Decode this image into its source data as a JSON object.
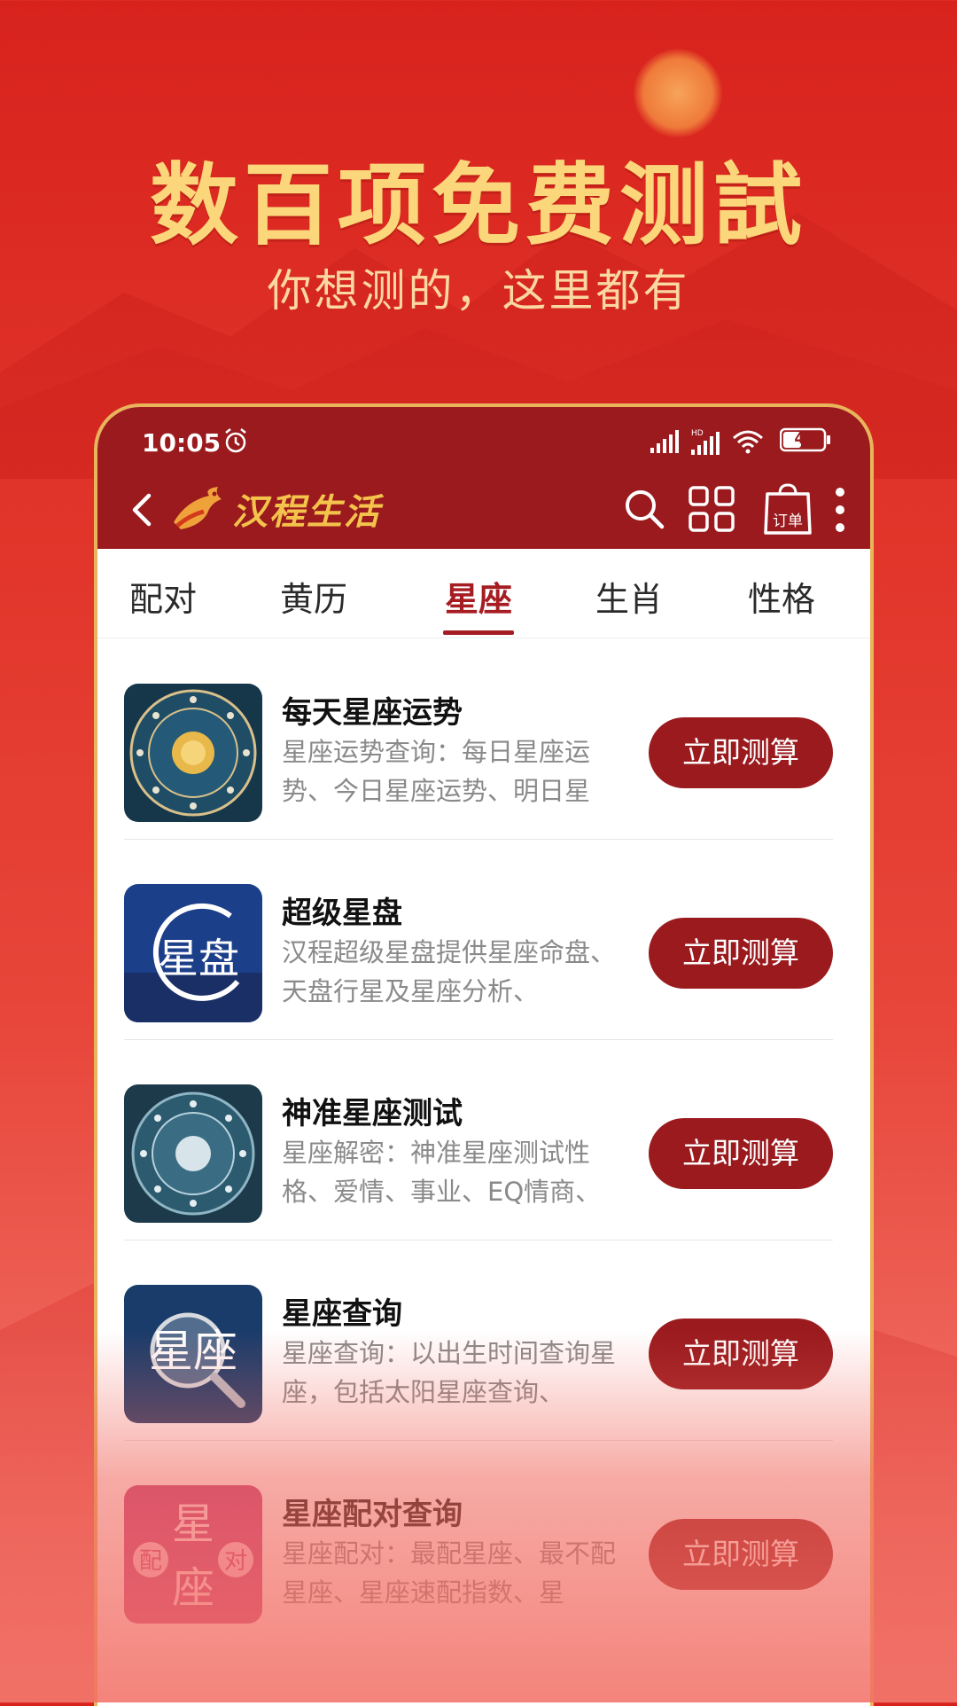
{
  "hero": {
    "title": "数百项免费测試",
    "subtitle": "你想测的，这里都有"
  },
  "status_bar": {
    "time": "10:05",
    "battery": "41",
    "icons": [
      "alarm-icon",
      "signal-icon",
      "hd-signal-icon",
      "wifi-icon",
      "battery-icon"
    ]
  },
  "app_bar": {
    "logo_text": "汉程生活",
    "order_label": "订单",
    "icons": [
      "back-icon",
      "search-icon",
      "grid-icon",
      "order-bag-icon",
      "more-icon"
    ]
  },
  "tabs": [
    {
      "label": "配对",
      "active": false
    },
    {
      "label": "黄历",
      "active": false
    },
    {
      "label": "星座",
      "active": true
    },
    {
      "label": "生肖",
      "active": false
    },
    {
      "label": "性格",
      "active": false
    }
  ],
  "items": [
    {
      "title": "每天星座运势",
      "desc": "星座运势查询：每日星座运势、今日星座运势、明日星",
      "button": "立即测算"
    },
    {
      "title": "超级星盘",
      "desc": "汉程超级星盘提供星座命盘、天盘行星及星座分析、",
      "button": "立即测算"
    },
    {
      "title": "神准星座测试",
      "desc": "星座解密：神准星座测试性格、爱情、事业、EQ情商、",
      "button": "立即测算"
    },
    {
      "title": "星座查询",
      "desc": "星座查询：以出生时间查询星座，包括太阳星座查询、",
      "button": "立即测算"
    },
    {
      "title": "星座配对查询",
      "desc": "星座配对：最配星座、最不配星座、星座速配指数、星",
      "button": "立即测算"
    }
  ],
  "thumb_text": {
    "pan": "星盘",
    "query": "星座",
    "pair_top": "星",
    "pair_bottom": "座",
    "pair_left": "配",
    "pair_right": "对"
  },
  "colors": {
    "brand_red": "#9a1a1e",
    "active_tab": "#a51d22",
    "gold": "#f4c34c"
  }
}
